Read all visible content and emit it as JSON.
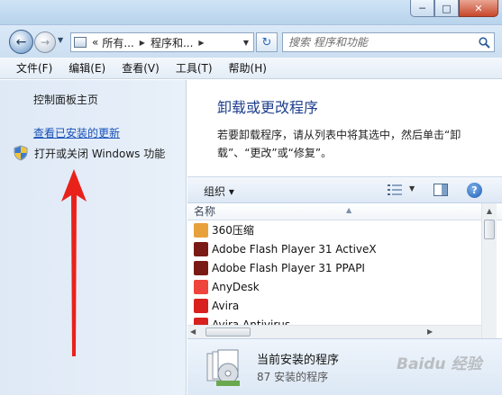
{
  "nav": {
    "breadcrumb": [
      "所有...",
      "程序和..."
    ],
    "breadcrumb_prefix": "«",
    "search_placeholder": "搜索 程序和功能"
  },
  "menu": [
    "文件(F)",
    "编辑(E)",
    "查看(V)",
    "工具(T)",
    "帮助(H)"
  ],
  "sidebar": {
    "home": "控制面板主页",
    "installed_updates": "查看已安装的更新",
    "windows_features": "打开或关闭 Windows 功能"
  },
  "main": {
    "title": "卸载或更改程序",
    "description": "若要卸载程序，请从列表中将其选中，然后单击“卸载”、“更改”或“修复”。"
  },
  "toolbar": {
    "organize": "组织 ▾",
    "help": "?"
  },
  "list": {
    "column_name": "名称",
    "rows": [
      {
        "name": "360压缩",
        "icon": "360zip-icon",
        "color": "#e8a13a"
      },
      {
        "name": "Adobe Flash Player 31 ActiveX",
        "icon": "flash-icon",
        "color": "#7a1a14"
      },
      {
        "name": "Adobe Flash Player 31 PPAPI",
        "icon": "flash-icon",
        "color": "#7a1a14"
      },
      {
        "name": "AnyDesk",
        "icon": "anydesk-icon",
        "color": "#ef443b"
      },
      {
        "name": "Avira",
        "icon": "avira-icon",
        "color": "#d8201f"
      },
      {
        "name": "Avira Antivirus",
        "icon": "avira-icon",
        "color": "#d8201f"
      }
    ]
  },
  "details": {
    "title": "当前安装的程序",
    "subtitle": "87 安装的程序"
  },
  "watermark": "Baidu 经验",
  "colors": {
    "accent_link": "#1650b8",
    "title_blue": "#1f3f8c",
    "annotation_arrow": "#e8221b"
  }
}
